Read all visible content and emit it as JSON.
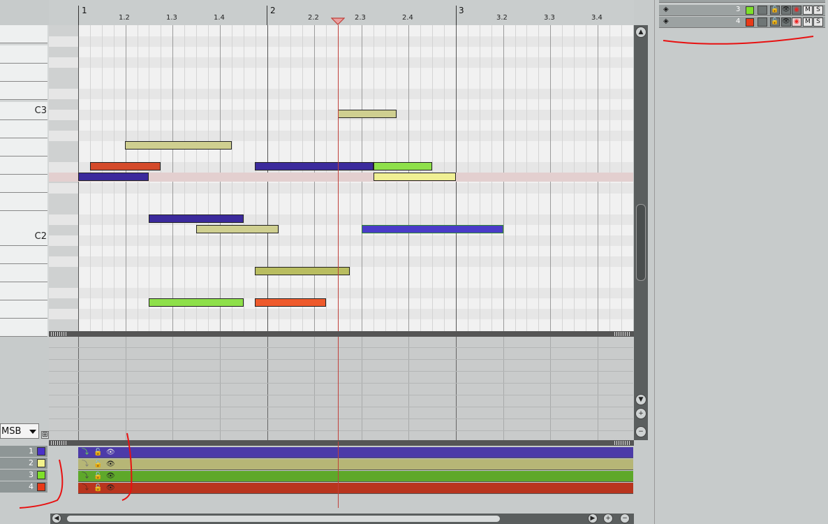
{
  "ruler": {
    "bars": [
      "1",
      "2",
      "3"
    ],
    "beats": [
      "1.2",
      "1.3",
      "1.4",
      "2.2",
      "2.3",
      "2.4",
      "3.2",
      "3.3",
      "3.4"
    ]
  },
  "keyboard": {
    "labels": [
      "C3",
      "C2"
    ]
  },
  "cc_lane": {
    "selector_value": "MSB",
    "expand_glyph": "⊞"
  },
  "channels": [
    {
      "num": "1",
      "color": "#4a32c8"
    },
    {
      "num": "2",
      "color": "#f2f28c"
    },
    {
      "num": "3",
      "color": "#7ee02a"
    },
    {
      "num": "4",
      "color": "#e83a18"
    }
  ],
  "tracks": [
    {
      "num": "3",
      "color": "#7ee02a",
      "mute": "M",
      "solo": "S"
    },
    {
      "num": "4",
      "color": "#e83a18",
      "mute": "M",
      "solo": "S"
    }
  ],
  "colors": {
    "note_purple": "#3b2a9c",
    "note_olive": "#cfcf90",
    "note_green": "#8ee04a",
    "note_yellow": "#f0f094",
    "note_red": "#d44a2a",
    "lane_purple": "#4c3ba8",
    "lane_olive": "#b6b676",
    "lane_green": "#5ea82a",
    "lane_red": "#b8351e",
    "playhead": "#c0403a",
    "annotation": "#e81010"
  },
  "icons": [
    "scroll-up-icon",
    "scroll-down-icon",
    "zoom-in-icon",
    "zoom-out-icon",
    "eye-icon",
    "lock-icon",
    "record-arm-icon"
  ]
}
